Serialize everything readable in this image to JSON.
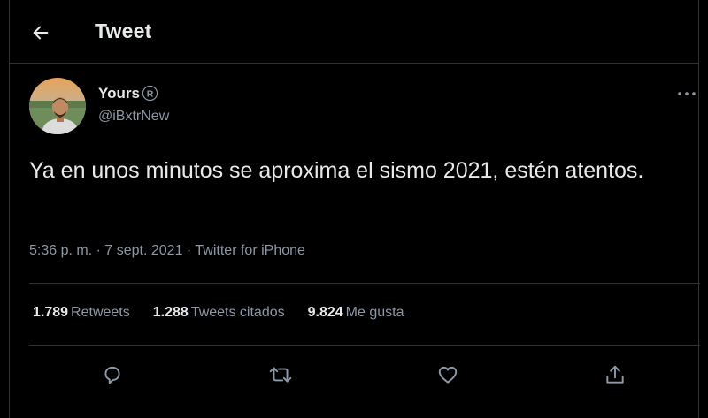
{
  "header": {
    "title": "Tweet",
    "back_icon": "arrow-left-icon"
  },
  "tweet": {
    "display_name": "Yours",
    "verified_icon": "registered-mark-icon",
    "handle": "@iBxtrNew",
    "text": "Ya en unos minutos se aproxima el sismo 2021, estén atentos.",
    "time": "5:36 p. m.",
    "date": "7 sept. 2021",
    "source": "Twitter for iPhone",
    "separator": "·",
    "more_icon": "more-dots-icon"
  },
  "stats": {
    "retweets_count": "1.789",
    "retweets_label": "Retweets",
    "quotes_count": "1.288",
    "quotes_label": "Tweets citados",
    "likes_count": "9.824",
    "likes_label": "Me gusta"
  },
  "actions": [
    "reply-icon",
    "retweet-icon",
    "like-icon",
    "share-icon"
  ],
  "colors": {
    "background": "#000000",
    "text": "#e7e9ea",
    "secondary_text": "#8b98a5",
    "border": "#2f3336"
  }
}
